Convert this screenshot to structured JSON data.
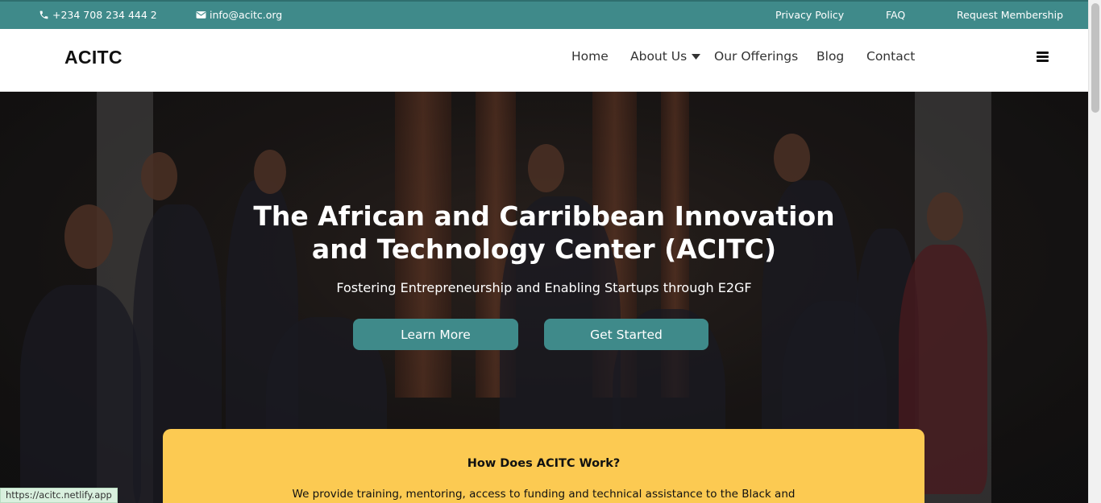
{
  "topbar": {
    "phone": "+234 708 234 444 2",
    "email": "info@acitc.org",
    "links": [
      "Privacy Policy",
      "FAQ",
      "Request Membership"
    ],
    "bg_color": "#3f8a8a"
  },
  "header": {
    "logo": "ACITC",
    "nav": [
      "Home",
      "About Us",
      "Our Offerings",
      "Blog",
      "Contact"
    ]
  },
  "hero": {
    "title_line1": "The African and Carribbean Innovation",
    "title_line2": "and Technology Center (ACITC)",
    "subtitle": "Fostering Entrepreneurship and Enabling Startups through E2GF",
    "buttons": [
      "Learn More",
      "Get Started"
    ],
    "button_color": "#3f8a8a"
  },
  "card": {
    "title": "How Does ACITC Work?",
    "text": "We provide training, mentoring, access to funding and technical assistance to the Black and",
    "bg_color": "#fcca52"
  },
  "status_url": "https://acitc.netlify.app"
}
